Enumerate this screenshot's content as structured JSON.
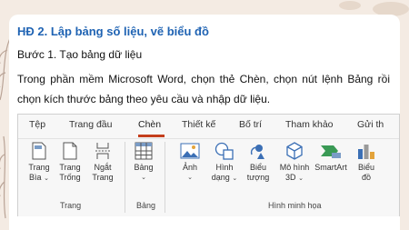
{
  "heading": "HĐ 2. Lập bảng số liệu, vẽ biểu đồ",
  "step": "Bước 1. Tạo bảng dữ liệu",
  "paragraph": "Trong phần mềm Microsoft Word, chọn thẻ Chèn, chọn nút lệnh Bảng rồi chọn kích thước bảng theo yêu cầu và nhập dữ liệu.",
  "ribbon": {
    "tabs": [
      "Tệp",
      "Trang đầu",
      "Chèn",
      "Thiết kế",
      "Bố trí",
      "Tham khảo",
      "Gửi th"
    ],
    "active_tab": "Chèn",
    "accent_color": "#c43e1c",
    "groups": {
      "trang": "Trang",
      "bang": "Bảng",
      "hinh_minh_hoa": "Hình minh họa"
    },
    "commands": {
      "trang_bia_1": "Trang",
      "trang_bia_2": "Bìa",
      "trang_trong_1": "Trang",
      "trang_trong_2": "Trống",
      "ngat_trang_1": "Ngắt",
      "ngat_trang_2": "Trang",
      "bang": "Bảng",
      "anh": "Ảnh",
      "hinh_dang_1": "Hình",
      "hinh_dang_2": "dạng",
      "bieu_tuong_1": "Biểu",
      "bieu_tuong_2": "tượng",
      "mo_hinh_1": "Mô hình",
      "mo_hinh_2": "3D",
      "smartart": "SmartArt",
      "bieu_do_1": "Biểu",
      "bieu_do_2": "đồ"
    },
    "icons": [
      "cover-page-icon",
      "blank-page-icon",
      "page-break-icon",
      "table-icon",
      "picture-icon",
      "shapes-icon",
      "icons-icon",
      "3d-model-icon",
      "smartart-icon",
      "chart-icon"
    ]
  }
}
